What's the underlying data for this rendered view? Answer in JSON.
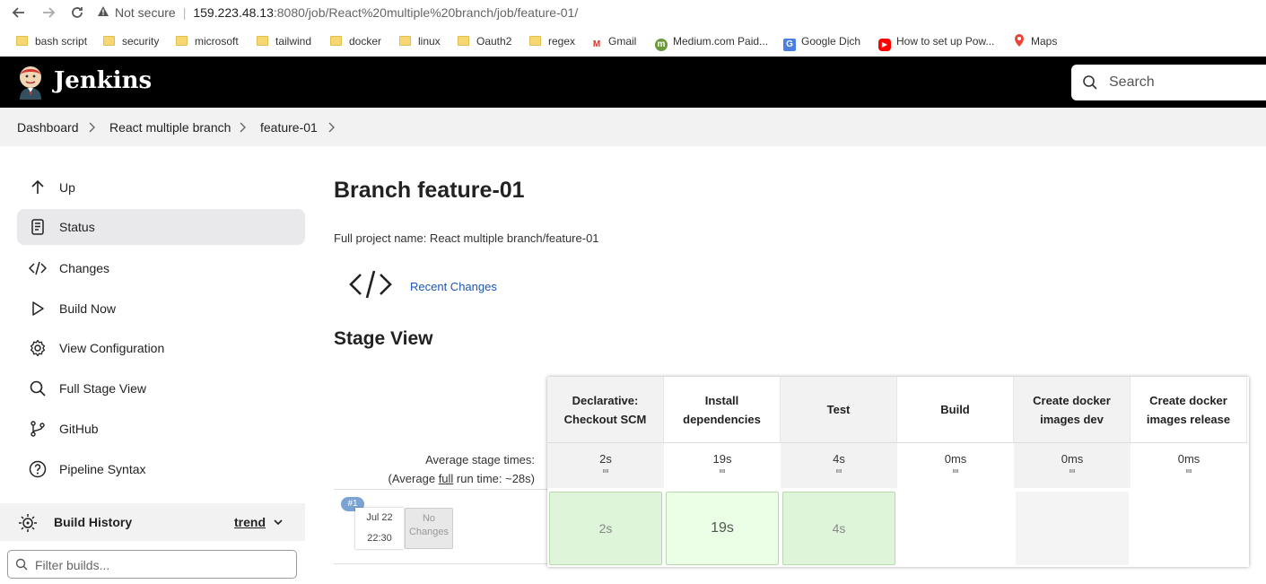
{
  "browser": {
    "security": "Not secure",
    "url_host": "159.223.48.13",
    "url_path": ":8080/job/React%20multiple%20branch/job/feature-01/",
    "bookmarks": [
      "bash script",
      "security",
      "microsoft",
      "tailwind",
      "docker",
      "linux",
      "Oauth2",
      "regex",
      "Gmail",
      "Medium.com Paid...",
      "Google Dịch",
      "How to set up Pow...",
      "Maps"
    ]
  },
  "header": {
    "title": "Jenkins",
    "search_placeholder": "Search"
  },
  "breadcrumb": [
    "Dashboard",
    "React multiple branch",
    "feature-01"
  ],
  "sidebar": {
    "items": [
      {
        "label": "Up",
        "icon": "arrow-up-icon"
      },
      {
        "label": "Status",
        "icon": "document-icon",
        "active": true
      },
      {
        "label": "Changes",
        "icon": "code-icon"
      },
      {
        "label": "Build Now",
        "icon": "play-icon"
      },
      {
        "label": "View Configuration",
        "icon": "gear-icon"
      },
      {
        "label": "Full Stage View",
        "icon": "search-icon"
      },
      {
        "label": "GitHub",
        "icon": "branch-icon"
      },
      {
        "label": "Pipeline Syntax",
        "icon": "help-icon"
      }
    ],
    "build_history": "Build History",
    "trend": "trend",
    "filter_placeholder": "Filter builds..."
  },
  "main": {
    "title": "Branch feature-01",
    "full_name": "Full project name: React multiple branch/feature-01",
    "recent_changes": "Recent Changes",
    "stage_view_title": "Stage View"
  },
  "stage_view": {
    "avg_label_1": "Average stage times:",
    "avg_label_2_pre": "(Average ",
    "avg_label_2_link": "full",
    "avg_label_2_post": " run time: ~28s)",
    "stages": [
      {
        "name": "Declarative: Checkout SCM",
        "avg": "2s",
        "cell": "2s",
        "status": "success"
      },
      {
        "name": "Install dependencies",
        "avg": "19s",
        "cell": "19s",
        "status": "success"
      },
      {
        "name": "Test",
        "avg": "4s",
        "cell": "4s",
        "status": "success"
      },
      {
        "name": "Build",
        "avg": "0ms",
        "cell": "",
        "status": "none"
      },
      {
        "name": "Create docker images dev",
        "avg": "0ms",
        "cell": "",
        "status": "none"
      },
      {
        "name": "Create docker images release",
        "avg": "0ms",
        "cell": "",
        "status": "none"
      }
    ],
    "build": {
      "number": "#1",
      "date": "Jul 22",
      "time": "22:30",
      "changes": "No Changes"
    }
  },
  "colors": {
    "header_bg": "#000000",
    "link": "#1b57b3",
    "success_cell": "#dff5d9"
  }
}
